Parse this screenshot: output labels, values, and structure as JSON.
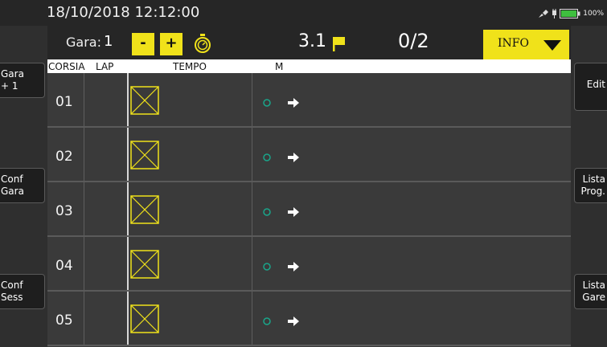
{
  "status": {
    "datetime": "18/10/2018 12:12:00",
    "battery_percent": "100%"
  },
  "header": {
    "gara_label": "Gara:",
    "gara_value": "1",
    "minus_label": "-",
    "plus_label": "+",
    "time_value": "3.1",
    "count_value": "0/2",
    "info_label": "INFO"
  },
  "columns": {
    "corsia": "CORSIA",
    "lap": "LAP",
    "tempo": "TEMPO",
    "m": "M"
  },
  "rows": [
    {
      "lane": "01"
    },
    {
      "lane": "02"
    },
    {
      "lane": "03"
    },
    {
      "lane": "04"
    },
    {
      "lane": "05"
    }
  ],
  "left_buttons": [
    {
      "line1": "Gara",
      "line2": "+ 1"
    },
    {
      "line1": "Conf",
      "line2": "Gara"
    },
    {
      "line1": "Conf",
      "line2": "Sess"
    }
  ],
  "right_buttons": [
    {
      "line1": "Edit",
      "line2": ""
    },
    {
      "line1": "Lista",
      "line2": "Prog."
    },
    {
      "line1": "Lista",
      "line2": "Gare"
    }
  ],
  "colors": {
    "accent": "#f0e21a",
    "status_circle": "#1aa58a",
    "background": "#3a3a3a"
  },
  "icons": {
    "stopwatch": "stopwatch-icon",
    "flag": "flag-icon",
    "dropdown": "triangle-down-icon",
    "time_placeholder": "crossed-box-icon",
    "marker": "circle-outline-icon",
    "next": "arrow-right-icon"
  }
}
